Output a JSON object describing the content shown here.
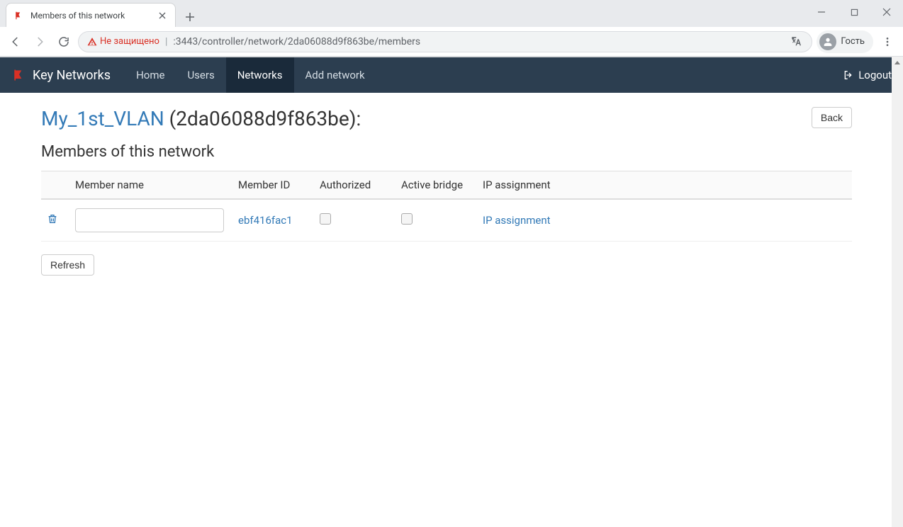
{
  "browser": {
    "tab_title": "Members of this network",
    "security_warning": "Не защищено",
    "url_visible": ":3443/controller/network/2da06088d9f863be/members",
    "guest_label": "Гость"
  },
  "navbar": {
    "brand": "Key Networks",
    "items": [
      {
        "label": "Home",
        "active": false
      },
      {
        "label": "Users",
        "active": false
      },
      {
        "label": "Networks",
        "active": true
      },
      {
        "label": "Add network",
        "active": false
      }
    ],
    "logout": "Logout"
  },
  "page": {
    "network_name": "My_1st_VLAN",
    "network_id_wrapped": "(2da06088d9f863be):",
    "back_label": "Back",
    "subheading": "Members of this network",
    "refresh_label": "Refresh"
  },
  "table": {
    "headers": {
      "delete": "",
      "member_name": "Member name",
      "member_id": "Member ID",
      "authorized": "Authorized",
      "active_bridge": "Active bridge",
      "ip_assignment": "IP assignment"
    },
    "rows": [
      {
        "member_name": "",
        "member_id": "ebf416fac1",
        "authorized": false,
        "active_bridge": false,
        "ip_assignment_label": "IP assignment"
      }
    ]
  }
}
